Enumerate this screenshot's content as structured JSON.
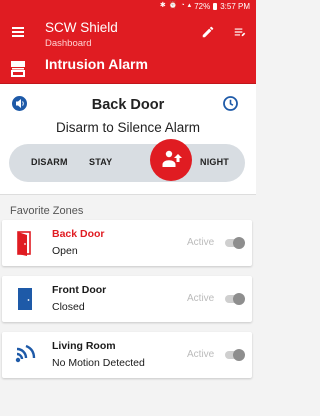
{
  "status_bar": {
    "icons": [
      "bluetooth-icon",
      "alarm-icon",
      "wifi-icon",
      "signal-icon"
    ],
    "battery": "72%",
    "time": "3:57 PM"
  },
  "header": {
    "title": "SCW Shield",
    "subtitle": "Dashboard",
    "accent_color": "#e01c22"
  },
  "alarm": {
    "title": "Intrusion Alarm"
  },
  "panel": {
    "zone": "Back Door",
    "message": "Disarm to Silence Alarm",
    "modes": {
      "disarm": "DISARM",
      "stay": "STAY",
      "away": "away-person-icon",
      "night": "NIGHT"
    },
    "selected_mode": "away"
  },
  "favorites": {
    "header": "Favorite Zones",
    "zones": [
      {
        "name": "Back Door",
        "state": "Open",
        "status": "Active",
        "icon": "open-door-icon",
        "alert": true
      },
      {
        "name": "Front Door",
        "state": "Closed",
        "status": "Active",
        "icon": "closed-door-icon",
        "alert": false
      },
      {
        "name": "Living Room",
        "state": "No Motion Detected",
        "status": "Active",
        "icon": "motion-sensor-icon",
        "alert": false
      }
    ]
  }
}
